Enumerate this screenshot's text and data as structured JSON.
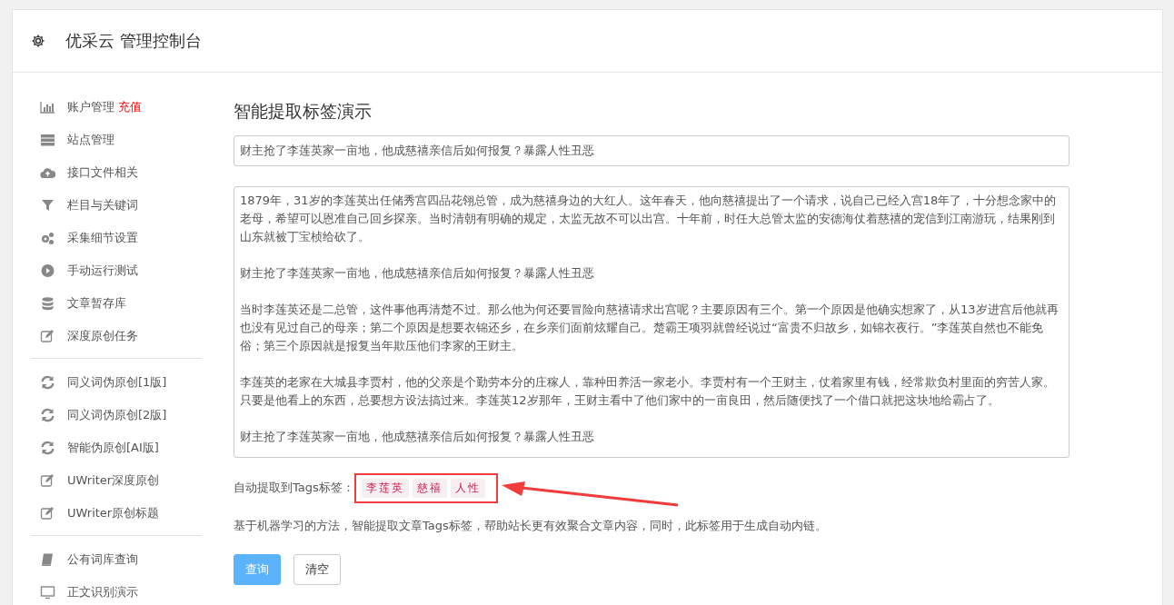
{
  "header": {
    "title": "优采云 管理控制台"
  },
  "sidebar": {
    "groups": [
      {
        "items": [
          {
            "kind": "chart",
            "label": "账户管理",
            "badge": "充值"
          },
          {
            "kind": "server",
            "label": "站点管理"
          },
          {
            "kind": "cloud",
            "label": "接口文件相关"
          },
          {
            "kind": "filter",
            "label": "栏目与关键词"
          },
          {
            "kind": "gears",
            "label": "采集细节设置"
          },
          {
            "kind": "play",
            "label": "手动运行测试"
          },
          {
            "kind": "database",
            "label": "文章暂存库"
          },
          {
            "kind": "edit",
            "label": "深度原创任务"
          }
        ]
      },
      {
        "items": [
          {
            "kind": "refresh",
            "label": "同义词伪原创[1版]"
          },
          {
            "kind": "refresh",
            "label": "同义词伪原创[2版]"
          },
          {
            "kind": "refresh",
            "label": "智能伪原创[AI版]"
          },
          {
            "kind": "edit",
            "label": "UWriter深度原创"
          },
          {
            "kind": "edit",
            "label": "UWriter原创标题"
          }
        ]
      },
      {
        "items": [
          {
            "kind": "book",
            "label": "公有词库查询"
          },
          {
            "kind": "monitor",
            "label": "正文识别演示"
          }
        ]
      }
    ]
  },
  "main": {
    "title": "智能提取标签演示",
    "title_field": {
      "value": "财主抢了李莲英家一亩地，他成慈禧亲信后如何报复？暴露人性丑恶"
    },
    "content_field": {
      "paragraphs": [
        "1879年，31岁的李莲英出任储秀宫四品花翎总管，成为慈禧身边的大红人。这年春天，他向慈禧提出了一个请求，说自己已经入宫18年了，十分想念家中的老母，希望可以恩准自己回乡探亲。当时清朝有明确的规定，太监无故不可以出宫。十年前，时任大总管太监的安德海仗着慈禧的宠信到江南游玩，结果刚到山东就被丁宝桢给砍了。",
        "财主抢了李莲英家一亩地，他成慈禧亲信后如何报复？暴露人性丑恶",
        "当时李莲英还是二总管，这件事他再清楚不过。那么他为何还要冒险向慈禧请求出宫呢？主要原因有三个。第一个原因是他确实想家了，从13岁进宫后他就再也没有见过自己的母亲；第二个原因是想要衣锦还乡，在乡亲们面前炫耀自己。楚霸王项羽就曾经说过“富贵不归故乡，如锦衣夜行。”李莲英自然也不能免俗；第三个原因就是报复当年欺压他们李家的王财主。",
        "李莲英的老家在大城县李贾村，他的父亲是个勤劳本分的庄稼人，靠种田养活一家老小。李贾村有一个王财主，仗着家里有钱，经常欺负村里面的穷苦人家。只要是他看上的东西，总要想方设法搞过来。李莲英12岁那年，王财主看中了他们家中的一亩良田，然后随便找了一个借口就把这块地给霸占了。",
        "财主抢了李莲英家一亩地，他成慈禧亲信后如何报复？暴露人性丑恶"
      ]
    },
    "tags_label": "自动提取到Tags标签：",
    "tags": [
      "李莲英",
      "慈禧",
      "人性"
    ],
    "description": "基于机器学习的方法，智能提取文章Tags标签，帮助站长更有效聚合文章内容，同时，此标签用于生成自动内链。",
    "buttons": [
      {
        "kind": "primary",
        "label": "查询"
      },
      {
        "kind": "default",
        "label": "清空"
      }
    ]
  }
}
